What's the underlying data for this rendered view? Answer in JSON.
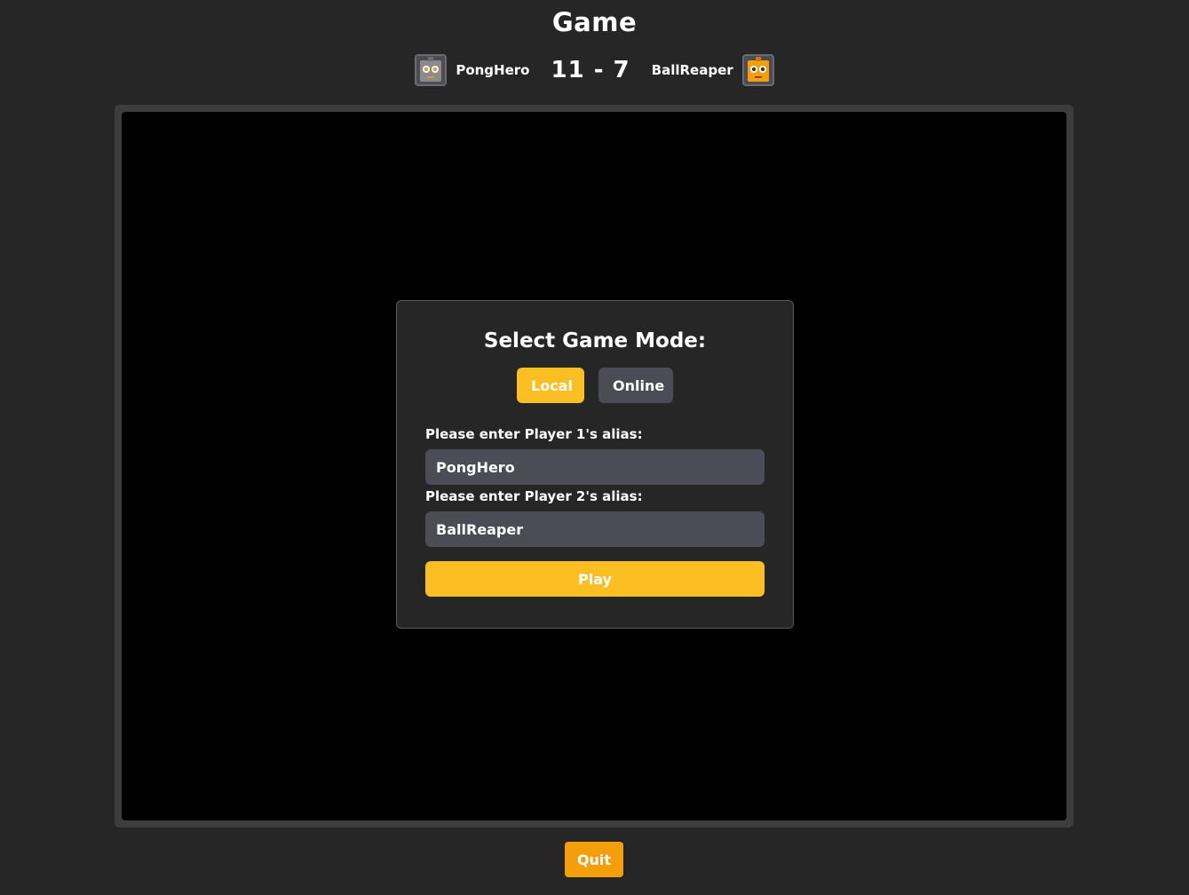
{
  "page": {
    "title": "Game"
  },
  "scoreboard": {
    "player1": {
      "name": "PongHero",
      "avatar_icon": "gray-robot-icon"
    },
    "score_text": "11 - 7",
    "player1_score": 11,
    "player2_score": 7,
    "player2": {
      "name": "BallReaper",
      "avatar_icon": "orange-robot-icon"
    }
  },
  "modal": {
    "title": "Select Game Mode:",
    "modes": {
      "local_label": "Local",
      "online_label": "Online",
      "selected": "Local"
    },
    "player1_label": "Please enter Player 1's alias:",
    "player1_value": "PongHero",
    "player2_label": "Please enter Player 2's alias:",
    "player2_value": "BallReaper",
    "play_label": "Play"
  },
  "actions": {
    "quit_label": "Quit"
  },
  "colors": {
    "accent": "#fbbf24",
    "quit": "#f59e0b",
    "secondary_button": "#4b4c55",
    "background": "#262626",
    "canvas": "#000000",
    "frame": "#3d3d3d"
  }
}
